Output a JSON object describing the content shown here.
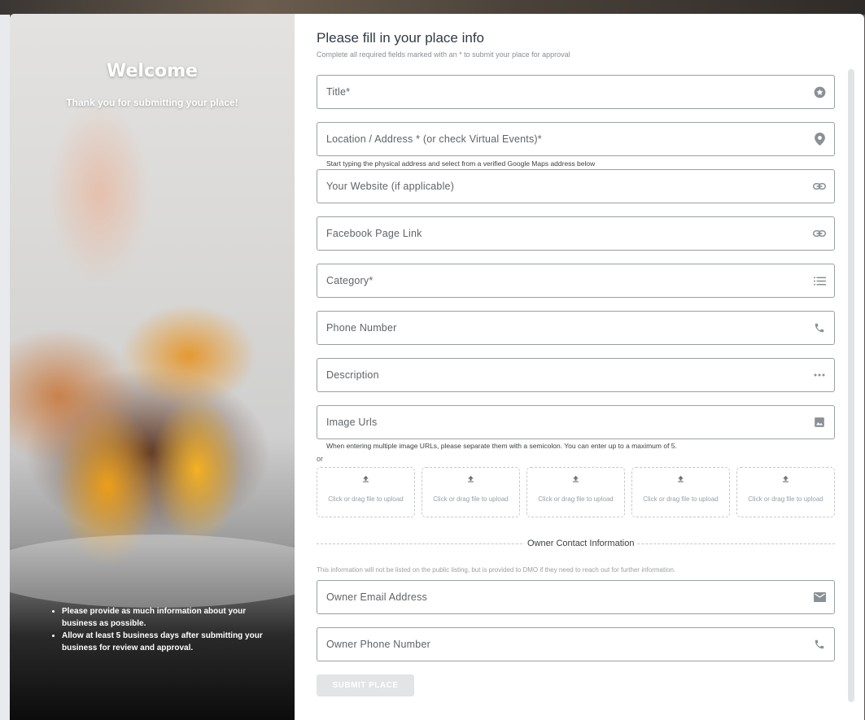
{
  "hero": {
    "title": "Welcome",
    "subtitle": "Thank you for submitting your place!",
    "bullets": [
      "Please provide as much information about your business as possible.",
      "Allow at least 5 business days after submitting your business for review and approval."
    ]
  },
  "form": {
    "title": "Please fill in your place info",
    "subtitle": "Complete all required fields marked with an * to submit your place for approval",
    "fields": {
      "title": "Title*",
      "location": "Location / Address * (or check Virtual Events)*",
      "website": "Your Website (if applicable)",
      "facebook": "Facebook Page Link",
      "category": "Category*",
      "phone": "Phone Number",
      "description": "Description",
      "image_urls": "Image Urls"
    },
    "location_hint": "Start typing the physical address and select from a verified Google Maps address below",
    "image_hint": "When entering multiple image URLs, please separate them with a semicolon. You can enter up to a maximum of 5.",
    "or_label": "or",
    "upload_label": "Click or drag file to upload",
    "owner_section_label": "Owner Contact Information",
    "owner_note": "This information will not be listed on the public listing, but is provided to DMO if they need to reach out for further information.",
    "owner_fields": {
      "email": "Owner Email Address",
      "phone": "Owner Phone Number"
    },
    "submit_label": "SUBMIT PLACE"
  },
  "icons": {
    "title": "star-circle-icon",
    "location": "map-pin-icon",
    "website": "link-icon",
    "facebook": "link-icon",
    "category": "list-icon",
    "phone": "phone-icon",
    "description": "more-dots-icon",
    "image_urls": "image-icon",
    "upload": "upload-arrow-icon",
    "owner_email": "mail-icon",
    "owner_phone": "phone-icon"
  }
}
